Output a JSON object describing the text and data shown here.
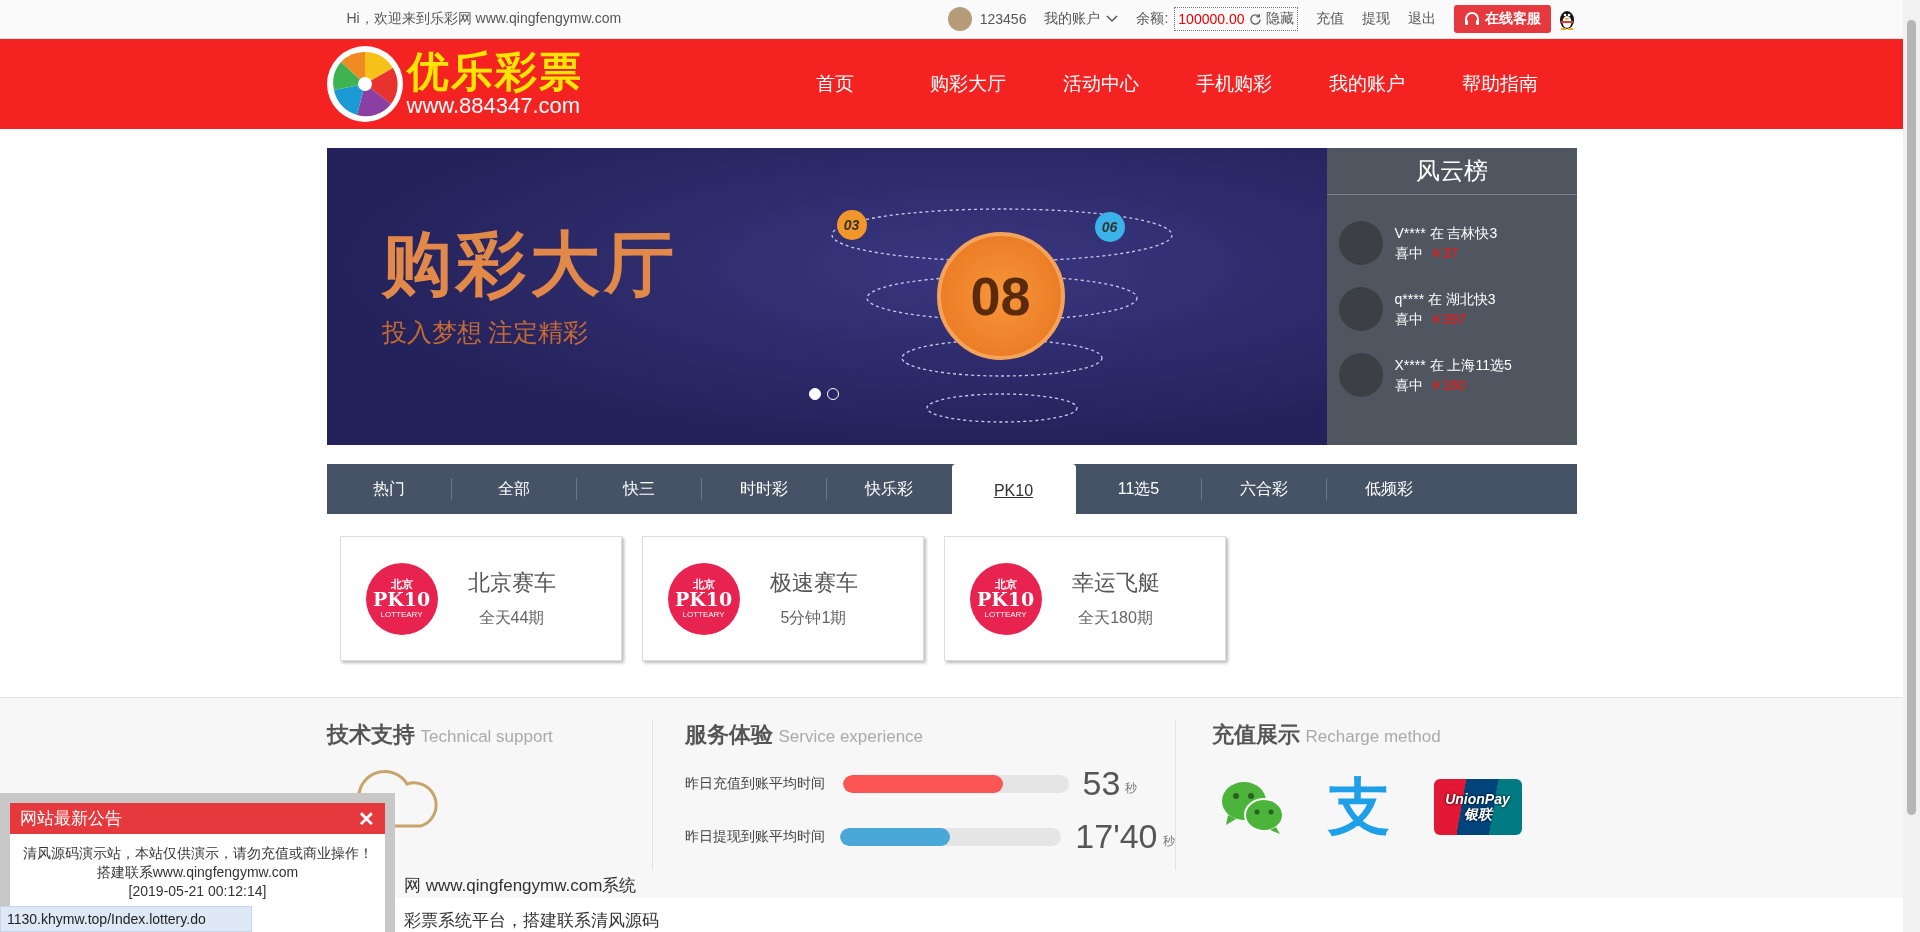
{
  "top_bar": {
    "welcome": "Hi，欢迎来到乐彩网 www.qingfengymw.com",
    "username": "123456",
    "account_menu": "我的账户",
    "balance_label": "余额:",
    "balance": "100000.00",
    "hide": "隐藏",
    "links": [
      "充值",
      "提现",
      "退出"
    ],
    "service_button": "在线客服"
  },
  "header": {
    "logo_name": "优乐彩票",
    "logo_url": "www.884347.com",
    "nav": [
      {
        "label": "首页"
      },
      {
        "label": "购彩大厅"
      },
      {
        "label": "活动中心"
      },
      {
        "label": "手机购彩"
      },
      {
        "label": "我的账户"
      },
      {
        "label": "帮助指南"
      }
    ]
  },
  "banner": {
    "title": "购彩大厅",
    "subtitle": "投入梦想  注定精彩",
    "balls": [
      {
        "kind": "main",
        "text": "08"
      },
      {
        "kind": "small",
        "text": "03",
        "color": "#f0962a"
      },
      {
        "kind": "small",
        "text": "06",
        "color": "#3bb3ea"
      }
    ],
    "carousel_dots": [
      {
        "selected": true
      },
      {
        "selected": false
      }
    ]
  },
  "ranking": {
    "title": "风云榜",
    "items": [
      {
        "line": "V**** 在 吉林快3",
        "won": "喜中",
        "amount": "￥37"
      },
      {
        "line": "q**** 在 湖北快3",
        "won": "喜中",
        "amount": "￥397"
      },
      {
        "line": "X**** 在 上海11选5",
        "won": "喜中",
        "amount": "￥160"
      }
    ]
  },
  "tabs": [
    {
      "label": "热门",
      "selected": false
    },
    {
      "label": "全部",
      "selected": false
    },
    {
      "label": "快三",
      "selected": false
    },
    {
      "label": "时时彩",
      "selected": false
    },
    {
      "label": "快乐彩",
      "selected": false
    },
    {
      "label": "PK10",
      "selected": true
    },
    {
      "label": "11选5",
      "selected": false
    },
    {
      "label": "六合彩",
      "selected": false
    },
    {
      "label": "低频彩",
      "selected": false
    }
  ],
  "games": [
    {
      "logo_top": "北京",
      "logo_main": "PK10",
      "logo_sub": "LOTTEARY",
      "name": "北京赛车",
      "schedule": "全天44期"
    },
    {
      "logo_top": "北京",
      "logo_main": "PK10",
      "logo_sub": "LOTTEARY",
      "name": "极速赛车",
      "schedule": "5分钟1期"
    },
    {
      "logo_top": "北京",
      "logo_main": "PK10",
      "logo_sub": "LOTTEARY",
      "name": "幸运飞艇",
      "schedule": "全天180期"
    }
  ],
  "footer": {
    "tech": {
      "title": "技术支持",
      "subtitle": "Technical support"
    },
    "service": {
      "title": "服务体验",
      "subtitle": "Service experience",
      "rows": [
        {
          "label": "昨日充值到账平均时间",
          "level": 0.71,
          "color": "#fb5555",
          "value": "53",
          "unit": "秒"
        },
        {
          "label": "昨日提现到账平均时间",
          "level": 0.5,
          "color": "#4aa8d8",
          "value": "17'40",
          "unit": "秒"
        }
      ]
    },
    "recharge": {
      "title": "充值展示",
      "subtitle": "Recharge method",
      "methods": [
        {
          "kind": "wechat"
        },
        {
          "kind": "alipay",
          "glyph": "支"
        },
        {
          "kind": "unionpay",
          "label": "UnionPay",
          "sub": "银联"
        }
      ]
    },
    "lines": [
      "网 www.qingfengymw.com系统",
      "彩票系统平台，搭建联系清风源码"
    ]
  },
  "notice": {
    "title": "网站最新公告",
    "close": "✕",
    "text": "清风源码演示站，本站仅供演示，请勿充值或商业操作！搭建联系www.qingfengymw.com",
    "date": "[2019-05-21 00:12:14]"
  },
  "status_url": "1130.khymw.top/Index.lottery.do"
}
